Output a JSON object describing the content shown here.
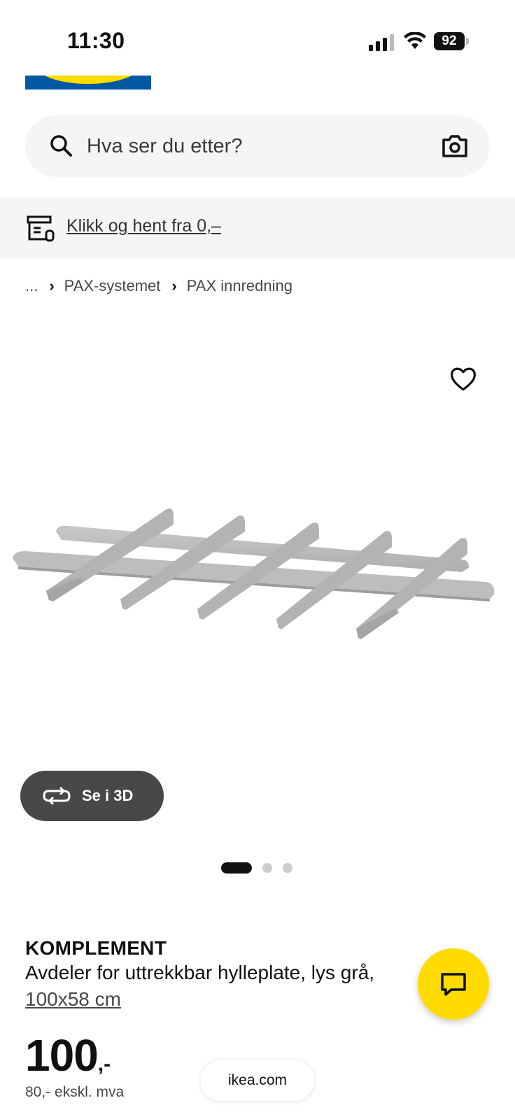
{
  "status_bar": {
    "time": "11:30",
    "battery": "92"
  },
  "search": {
    "placeholder": "Hva ser du etter?"
  },
  "banner": {
    "link_text": "Klikk og hent fra 0,–"
  },
  "breadcrumb": {
    "ellipsis": "...",
    "items": [
      "PAX-systemet",
      "PAX innredning"
    ]
  },
  "gallery": {
    "view3d_label": "Se i 3D",
    "slides": 3,
    "active_slide": 1
  },
  "product": {
    "name": "KOMPLEMENT",
    "description": "Avdeler for uttrekkbar hylleplate, lys grå,",
    "size": "100x58 cm",
    "price_integer": "100",
    "price_suffix": ",-",
    "price_ex_vat": "80,- ekskl. mva"
  },
  "browser": {
    "url": "ikea.com"
  },
  "colors": {
    "brand_blue": "#0058a3",
    "brand_yellow": "#ffdb00",
    "surface": "#f5f5f5"
  }
}
